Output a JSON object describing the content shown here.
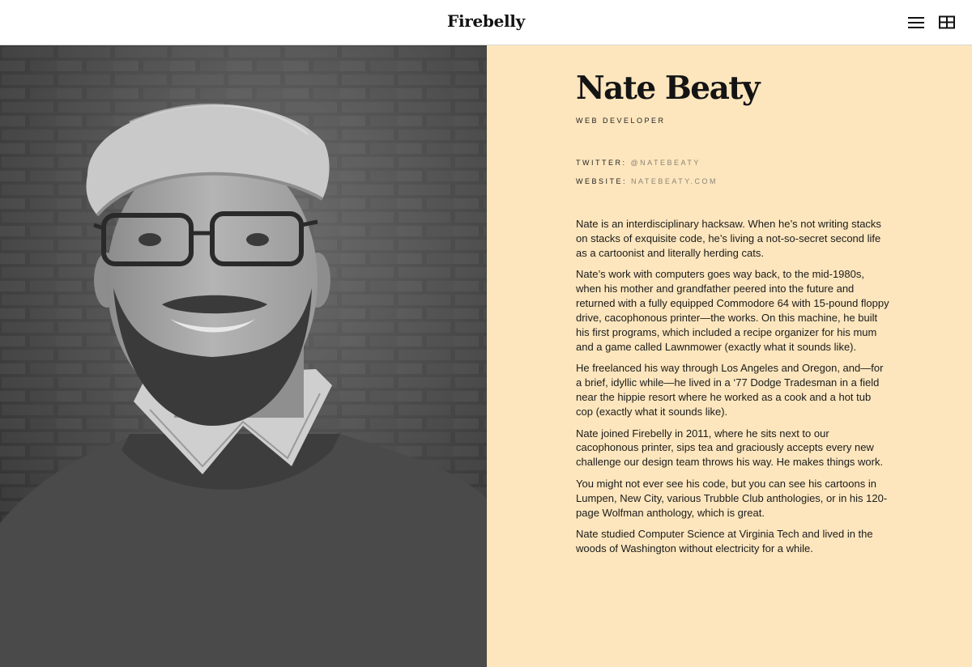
{
  "header": {
    "logo": "Firebelly",
    "menu_icon": "hamburger-menu-icon",
    "grid_icon": "grid-layout-icon"
  },
  "photo": {
    "alt": "Portrait photo of Nate Beaty"
  },
  "profile": {
    "name": "Nate Beaty",
    "role": "WEB DEVELOPER",
    "twitter_label": "TWITTER:",
    "twitter_value": "@NATEBEATY",
    "website_label": "WEBSITE:",
    "website_value": "NATEBEATY.COM"
  },
  "bio": {
    "paragraphs": [
      "Nate is an interdisciplinary hacksaw. When he’s not writing stacks on stacks of exquisite code, he’s living a not-so-secret second life as a cartoonist and literally herding cats.",
      "Nate’s work with computers goes way back, to the mid-1980s, when his mother and grandfather peered into the future and returned with a fully equipped Commodore 64 with 15-pound floppy drive, cacophonous printer—the works. On this machine, he built his first programs, which included a recipe organizer for his mum and a game called Lawnmower (exactly what it sounds like).",
      "He freelanced his way through Los Angeles and Oregon, and—for a brief, idyllic while—he lived in a ‘77 Dodge Tradesman in a field near the hippie resort where he worked as a cook and a hot tub cop (exactly what it sounds like).",
      "Nate joined Firebelly in 2011, where he sits next to our cacophonous printer, sips tea and graciously accepts every new challenge our design team throws his way. He makes things work.",
      "You might not ever see his code, but you can see his cartoons in Lumpen, New City, various Trubble Club anthologies, or in his 120-page Wolfman anthology, which is great.",
      "Nate studied Computer Science at Virginia Tech and lived in the woods of Washington without electricity for a while."
    ]
  },
  "colors": {
    "panel_background": "#fde6bd",
    "text": "#1b1b1b",
    "muted": "#8a8478"
  }
}
